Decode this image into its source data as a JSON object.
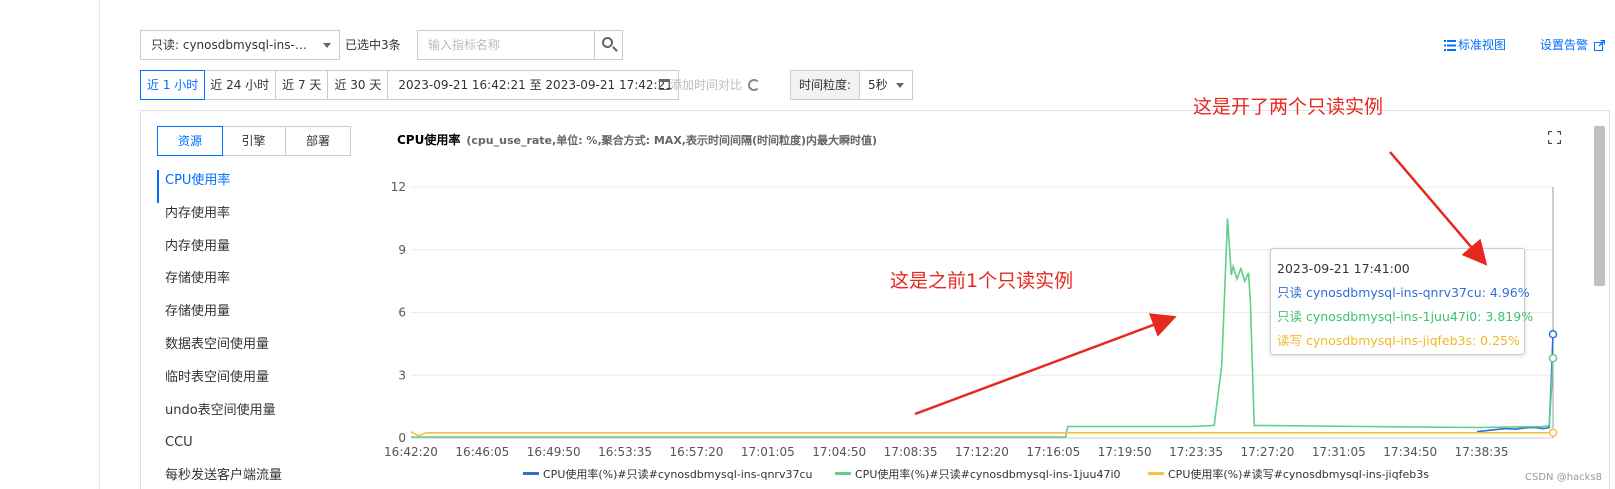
{
  "toolbar": {
    "instance_select": "只读: cynosdbmysql-ins-1juu...",
    "selected_count": "已选中3条",
    "search_placeholder": "输入指标名称",
    "standard_view": "标准视图",
    "alarm_settings": "设置告警"
  },
  "time": {
    "tabs": [
      "近 1 小时",
      "近 24 小时",
      "近 7 天",
      "近 30 天"
    ],
    "active_tab": "近 1 小时",
    "range": "2023-09-21 16:42:21 至 2023-09-21 17:42:21",
    "compare": "添加时间对比",
    "granularity_label": "时间粒度:",
    "granularity_value": "5秒"
  },
  "segments": [
    "资源",
    "引擎",
    "部署"
  ],
  "active_segment": "资源",
  "metrics": [
    "CPU使用率",
    "内存使用率",
    "内存使用量",
    "存储使用率",
    "存储使用量",
    "数据表空间使用量",
    "临时表空间使用量",
    "undo表空间使用量",
    "CCU",
    "每秒发送客户端流量"
  ],
  "active_metric": "CPU使用率",
  "chart_header": {
    "title": "CPU使用率",
    "subtitle": "(cpu_use_rate,单位: %,聚合方式: MAX,表示时间间隔(时间粒度)内最大瞬时值)"
  },
  "tooltip": {
    "time": "2023-09-21 17:41:00",
    "rows": [
      "只读 cynosdbmysql-ins-qnrv37cu: 4.96%",
      "只读 cynosdbmysql-ins-1juu47i0: 3.819%",
      "读写 cynosdbmysql-ins-jiqfeb3s: 0.25%"
    ]
  },
  "annotations": {
    "top_right": "这是开了两个只读实例",
    "middle": "这是之前1个只读实例"
  },
  "watermark": "CSDN @hacks8",
  "colors": {
    "accent": "#006eff",
    "series_blue": "#2f6fd6",
    "series_green": "#5fcf8a",
    "series_yellow": "#f5c242",
    "annotation_red": "#e8271f"
  },
  "chart_data": {
    "type": "line",
    "xlabels": [
      "16:42:20",
      "16:46:05",
      "16:49:50",
      "16:53:35",
      "16:57:20",
      "17:01:05",
      "17:04:50",
      "17:08:35",
      "17:12:20",
      "17:16:05",
      "17:19:50",
      "17:23:35",
      "17:27:20",
      "17:31:05",
      "17:34:50",
      "17:38:35"
    ],
    "yticks": [
      0,
      3,
      6,
      9,
      12
    ],
    "ylim": [
      0,
      12
    ],
    "grid": true,
    "legend_position": "bottom",
    "series": [
      {
        "name": "CPU使用率(%)#只读#cynosdbmysql-ins-qnrv37cu",
        "color": "#2f6fd6",
        "points": [
          [
            56.0,
            0.3
          ],
          [
            57.0,
            0.4
          ],
          [
            57.5,
            0.45
          ],
          [
            58.0,
            0.42
          ],
          [
            58.5,
            0.48
          ],
          [
            59.0,
            0.5
          ],
          [
            59.5,
            0.45
          ],
          [
            59.8,
            0.5
          ],
          [
            59.9,
            2.5
          ],
          [
            60.0,
            4.96
          ]
        ]
      },
      {
        "name": "CPU使用率(%)#只读#cynosdbmysql-ins-1juu47i0",
        "color": "#5fcf8a",
        "points": [
          [
            0.0,
            0.05
          ],
          [
            15.0,
            0.05
          ],
          [
            34.4,
            0.05
          ],
          [
            34.5,
            0.55
          ],
          [
            41.0,
            0.55
          ],
          [
            42.2,
            0.6
          ],
          [
            42.6,
            3.5
          ],
          [
            42.9,
            10.5
          ],
          [
            43.1,
            7.8
          ],
          [
            43.2,
            8.2
          ],
          [
            43.4,
            7.6
          ],
          [
            43.6,
            8.1
          ],
          [
            43.8,
            7.5
          ],
          [
            44.0,
            7.9
          ],
          [
            44.1,
            6.5
          ],
          [
            44.3,
            0.6
          ],
          [
            50.0,
            0.55
          ],
          [
            56.0,
            0.5
          ],
          [
            59.5,
            0.55
          ],
          [
            59.8,
            0.6
          ],
          [
            59.9,
            2.0
          ],
          [
            60.0,
            3.819
          ]
        ]
      },
      {
        "name": "CPU使用率(%)#读写#cynosdbmysql-ins-jiqfeb3s",
        "color": "#f5c242",
        "points": [
          [
            0.0,
            0.3
          ],
          [
            0.4,
            0.1
          ],
          [
            0.8,
            0.25
          ],
          [
            10.0,
            0.25
          ],
          [
            20.0,
            0.25
          ],
          [
            30.0,
            0.25
          ],
          [
            40.0,
            0.25
          ],
          [
            50.0,
            0.25
          ],
          [
            60.0,
            0.25
          ]
        ]
      }
    ]
  }
}
